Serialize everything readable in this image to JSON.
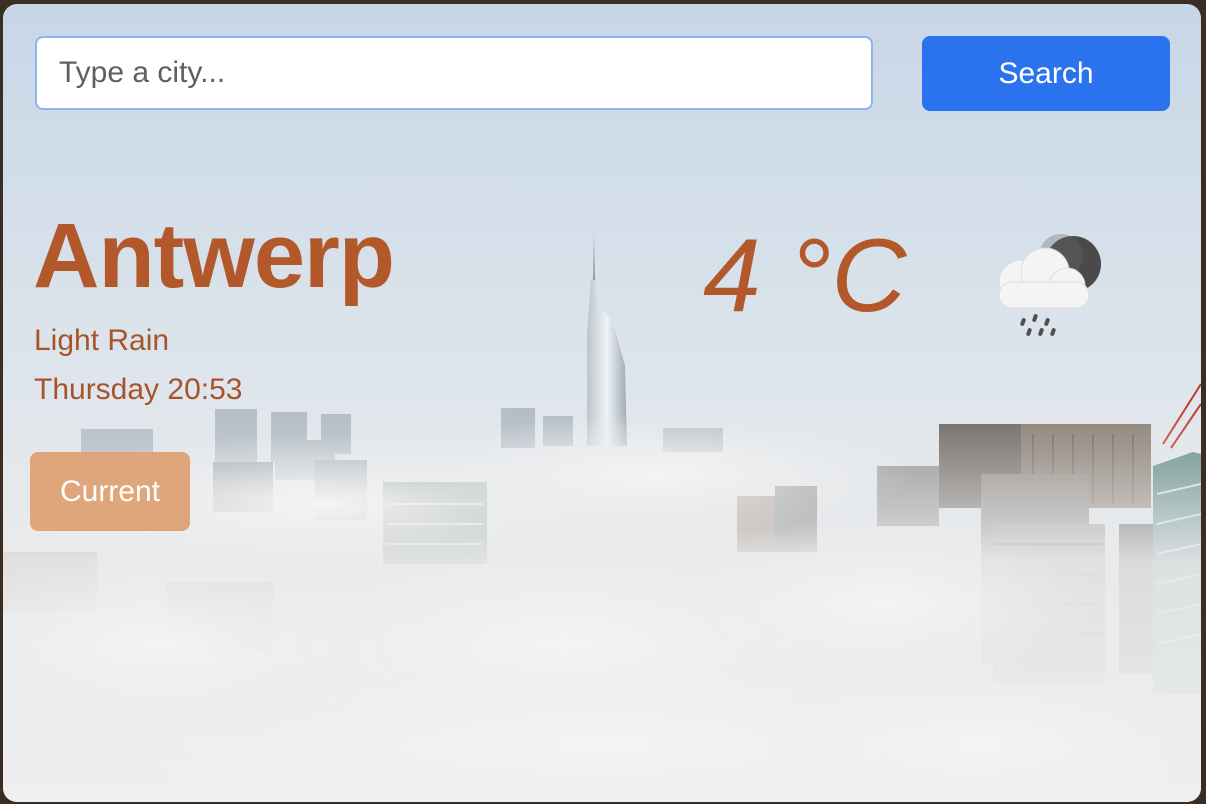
{
  "search": {
    "placeholder": "Type a city...",
    "value": "",
    "button_label": "Search"
  },
  "weather": {
    "city": "Antwerp",
    "condition": "Light Rain",
    "datetime": "Thursday 20:53",
    "temperature": "4 °C",
    "icon": "rain-cloud-night-icon"
  },
  "actions": {
    "current_label": "Current"
  },
  "colors": {
    "accent_text": "#b2582a",
    "search_button": "#2b72ee",
    "current_button": "#dfa57b"
  }
}
